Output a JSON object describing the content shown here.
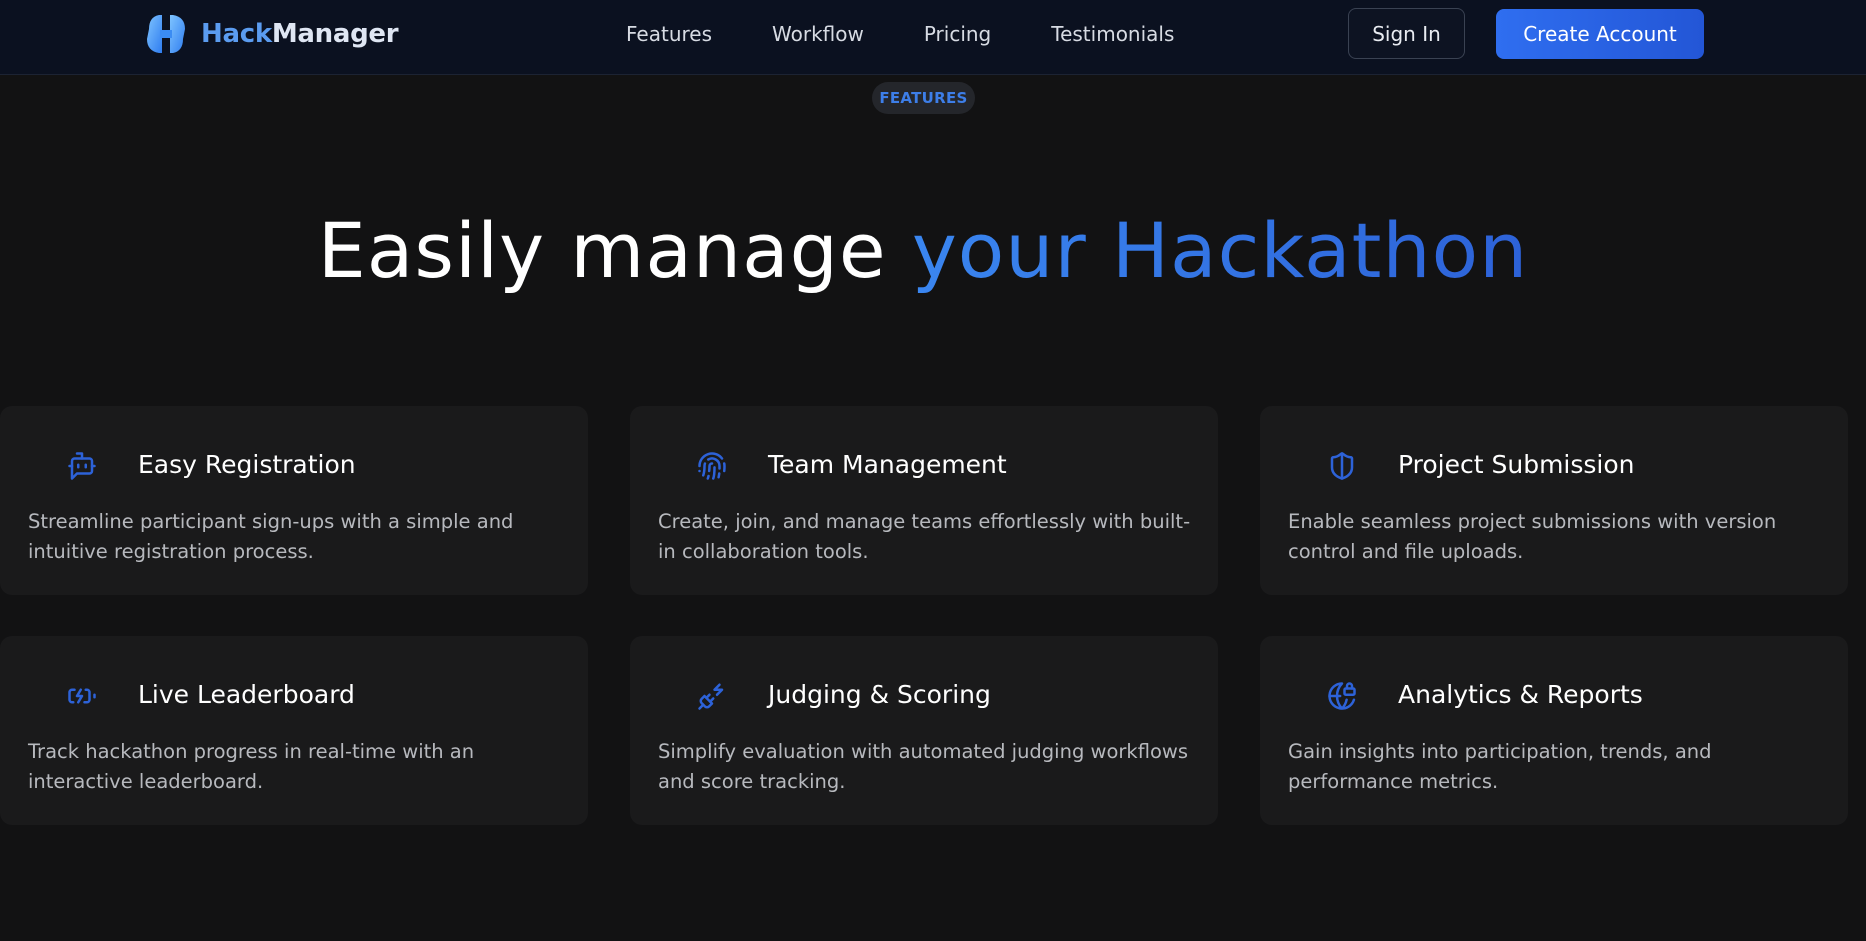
{
  "colors": {
    "accent": "#2f6ef0",
    "background": "#121213",
    "navbar": "#0b1120",
    "card": "#1a1a1b",
    "icon": "#2d62d8"
  },
  "navbar": {
    "brand": {
      "logo_icon": "hackmanager-logo-icon",
      "name_part1": "Hack",
      "name_part2": "Manager"
    },
    "links": [
      "Features",
      "Workflow",
      "Pricing",
      "Testimonials"
    ],
    "signin_label": "Sign In",
    "create_label": "Create Account"
  },
  "hero": {
    "badge": "FEATURES",
    "title_plain": "Easily manage ",
    "title_accent": "your Hackathon"
  },
  "features": [
    {
      "icon": "bot-icon",
      "title": "Easy Registration",
      "description": "Streamline participant sign-ups with a simple and intuitive registration process."
    },
    {
      "icon": "fingerprint-icon",
      "title": "Team Management",
      "description": "Create, join, and manage teams effortlessly with built-in collaboration tools."
    },
    {
      "icon": "shield-icon",
      "title": "Project Submission",
      "description": "Enable seamless project submissions with version control and file uploads."
    },
    {
      "icon": "battery-charging-icon",
      "title": "Live Leaderboard",
      "description": "Track hackathon progress in real-time with an interactive leaderboard."
    },
    {
      "icon": "plug-zap-icon",
      "title": "Judging & Scoring",
      "description": "Simplify evaluation with automated judging workflows and score tracking."
    },
    {
      "icon": "globe-lock-icon",
      "title": "Analytics & Reports",
      "description": "Gain insights into participation, trends, and performance metrics."
    }
  ]
}
